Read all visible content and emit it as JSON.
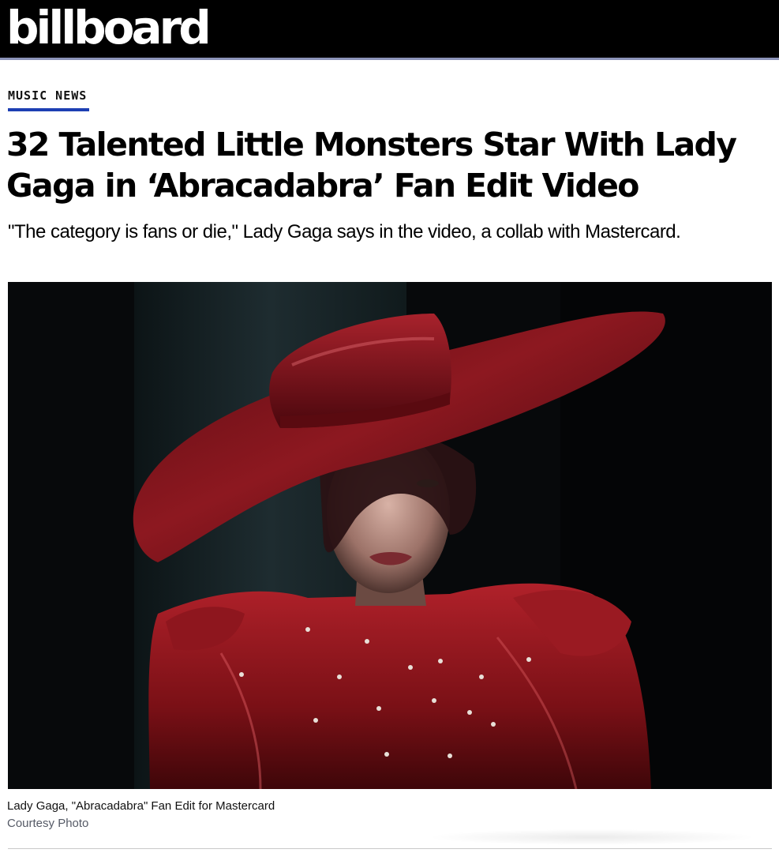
{
  "header": {
    "logo_text": "billboard",
    "background_color": "#000000",
    "accent_line_color": "#8c93b8"
  },
  "article": {
    "category": "MUSIC NEWS",
    "category_underline_color": "#1d3fb3",
    "headline": "32 Talented Little Monsters Star With Lady Gaga in ‘Abracadabra’ Fan Edit Video",
    "dek": "\"The category is fans or die,\" Lady Gaga says in the video, a collab with Mastercard.",
    "image": {
      "caption": "Lady Gaga, \"Abracadabra\" Fan Edit for Mastercard",
      "credit": "Courtesy Photo"
    }
  }
}
